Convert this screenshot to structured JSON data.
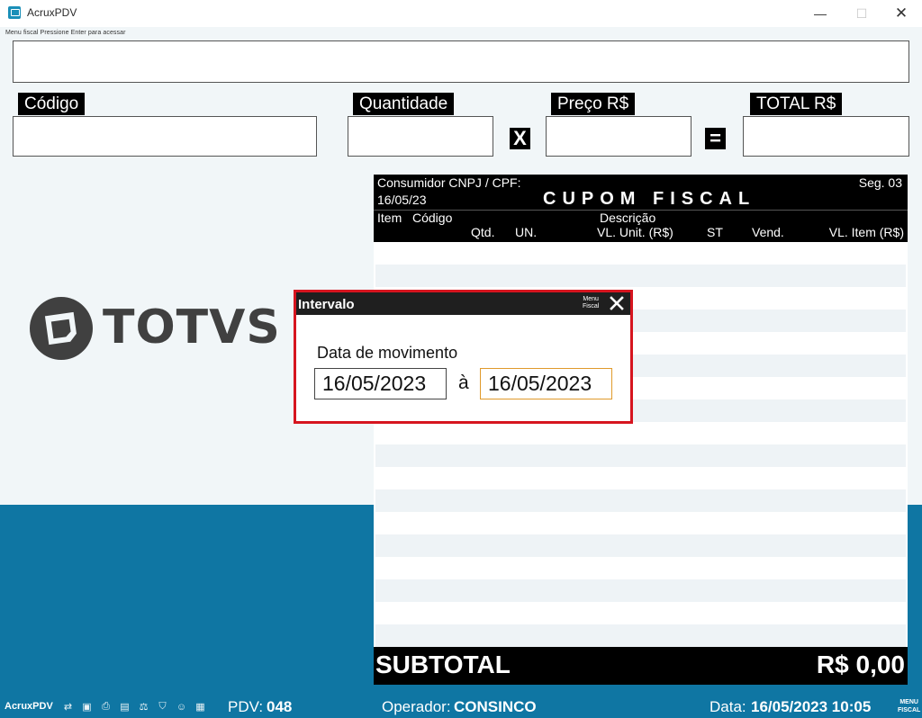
{
  "window": {
    "title": "AcruxPDV",
    "min_symbol": "—",
    "max_symbol": "☐",
    "close_symbol": "✕"
  },
  "menu_hint": "Menu fiscal Pressione Enter para acessar",
  "fields": {
    "codigo_label": "Código",
    "quantidade_label": "Quantidade",
    "preco_label": "Preço R$",
    "total_label": "TOTAL R$",
    "times_sign": "X",
    "equals_sign": "="
  },
  "logo": {
    "text": "TOTVS VAREJO",
    "icon": "totvs-logo-icon"
  },
  "cupom": {
    "consumidor": "Consumidor CNPJ / CPF:",
    "seg": "Seg. 03",
    "date": "16/05/23",
    "title": "CUPOM FISCAL",
    "columns": {
      "item": "Item",
      "codigo": "Código",
      "descricao": "Descrição",
      "qtd": "Qtd.",
      "un": "UN.",
      "vl_unit": "VL. Unit. (R$)",
      "st": "ST",
      "vend": "Vend.",
      "vl_item": "VL. Item (R$)"
    },
    "subtotal_label": "SUBTOTAL",
    "subtotal_value": "R$ 0,00"
  },
  "dialog": {
    "title": "Intervalo",
    "menu_line1": "Menu",
    "menu_line2": "Fiscal",
    "label": "Data de movimento",
    "date_from": "16/05/2023",
    "date_sep": "à",
    "date_to": "16/05/2023"
  },
  "statusbar": {
    "app": "AcruxPDV",
    "icons": [
      "network-icon",
      "monitor-icon",
      "printer-icon",
      "card-reader-icon",
      "scale-icon",
      "shield-icon",
      "user-icon",
      "keyboard-icon"
    ],
    "pdv_label": "PDV:",
    "pdv_value": "048",
    "operador_label": "Operador:",
    "operador_value": "CONSINCO",
    "data_label": "Data:",
    "data_value": "16/05/2023 10:05",
    "menu_line1": "MENU",
    "menu_line2": "FISCAL"
  },
  "colors": {
    "accent_blue": "#0f76a3",
    "dialog_border": "#d6151f",
    "focus_border": "#e09a2b",
    "row_stripe": "#eef3f6"
  }
}
